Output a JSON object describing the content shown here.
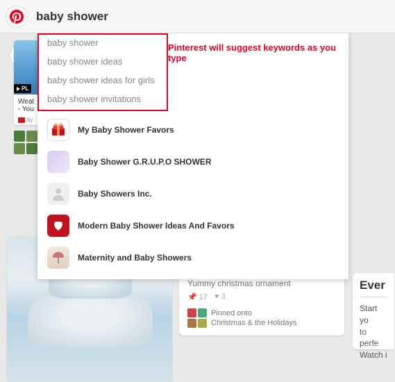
{
  "header": {
    "search_value": "baby shower"
  },
  "annotation": "Pinterest will suggest keywords as you type",
  "suggestions": [
    "baby shower",
    "baby shower ideas",
    "baby shower ideas for girls",
    "baby shower invitations"
  ],
  "users": [
    {
      "name": "My Baby Shower Favors"
    },
    {
      "name": "Baby Shower G.R.U.P.O SHOWER"
    },
    {
      "name": "Baby Showers Inc."
    },
    {
      "name": "Modern Baby Shower Ideas And Favors"
    },
    {
      "name": "Maternity and Baby Showers"
    }
  ],
  "bg": {
    "video_pin": {
      "title_line1": "Weat",
      "title_line2": "- You",
      "by_prefix": "by",
      "play_label": "PL"
    },
    "yummy_pin": {
      "title": "Yummy christmas ornament",
      "pins_count": "17",
      "likes_count": "3",
      "pinned_label": "Pinned onto",
      "board_name": "Christmas & the Holidays"
    },
    "ever_card": {
      "title": "Ever",
      "line1": "Start yo",
      "line2": "to perfe",
      "line3": "Watch i"
    }
  },
  "icons": {
    "pin": "📌",
    "heart": "♥"
  },
  "colors": {
    "pinterest_red": "#e60023",
    "annotation_red": "#e60023"
  }
}
